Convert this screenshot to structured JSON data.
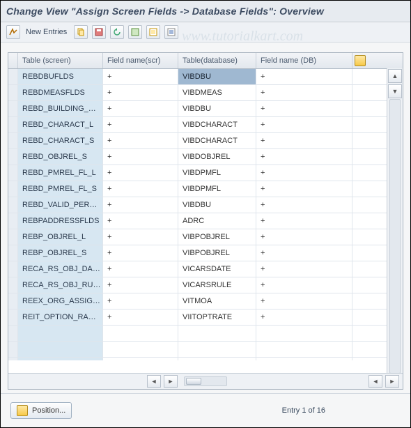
{
  "watermark": "www.tutorialkart.com",
  "title": "Change View \"Assign Screen Fields -> Database Fields\": Overview",
  "toolbar": {
    "new_entries_label": "New Entries"
  },
  "columns": {
    "c1": "Table (screen)",
    "c2": "Field name(scr)",
    "c3": "Table(database)",
    "c4": "Field name (DB)"
  },
  "rows": [
    {
      "ts": "REBDBUFLDS",
      "fs": "+",
      "td": "VIBDBU",
      "fd": "+",
      "sel": true
    },
    {
      "ts": "REBDMEASFLDS",
      "fs": "+",
      "td": "VIBDMEAS",
      "fd": "+"
    },
    {
      "ts": "REBD_BUILDING_…",
      "fs": "+",
      "td": "VIBDBU",
      "fd": "+"
    },
    {
      "ts": "REBD_CHARACT_L",
      "fs": "+",
      "td": "VIBDCHARACT",
      "fd": "+"
    },
    {
      "ts": "REBD_CHARACT_S",
      "fs": "+",
      "td": "VIBDCHARACT",
      "fd": "+"
    },
    {
      "ts": "REBD_OBJREL_S",
      "fs": "+",
      "td": "VIBDOBJREL",
      "fd": "+"
    },
    {
      "ts": "REBD_PMREL_FL_L",
      "fs": "+",
      "td": "VIBDPMFL",
      "fd": "+"
    },
    {
      "ts": "REBD_PMREL_FL_S",
      "fs": "+",
      "td": "VIBDPMFL",
      "fd": "+"
    },
    {
      "ts": "REBD_VALID_PER…",
      "fs": "+",
      "td": "VIBDBU",
      "fd": "+"
    },
    {
      "ts": "REBPADDRESSFLDS",
      "fs": "+",
      "td": "ADRC",
      "fd": "+"
    },
    {
      "ts": "REBP_OBJREL_L",
      "fs": "+",
      "td": "VIBPOBJREL",
      "fd": "+"
    },
    {
      "ts": "REBP_OBJREL_S",
      "fs": "+",
      "td": "VIBPOBJREL",
      "fd": "+"
    },
    {
      "ts": "RECA_RS_OBJ_DA…",
      "fs": "+",
      "td": "VICARSDATE",
      "fd": "+"
    },
    {
      "ts": "RECA_RS_OBJ_RU…",
      "fs": "+",
      "td": "VICARSRULE",
      "fd": "+"
    },
    {
      "ts": "REEX_ORG_ASSIG…",
      "fs": "+",
      "td": "VITMOA",
      "fd": "+"
    },
    {
      "ts": "REIT_OPTION_RA…",
      "fs": "+",
      "td": "VIITOPTRATE",
      "fd": "+"
    },
    {
      "ts": "",
      "fs": "",
      "td": "",
      "fd": ""
    },
    {
      "ts": "",
      "fs": "",
      "td": "",
      "fd": ""
    },
    {
      "ts": "",
      "fs": "",
      "td": "",
      "fd": ""
    }
  ],
  "footer": {
    "position_label": "Position...",
    "entry_text": "Entry 1 of 16"
  },
  "icons": {
    "toggle": "toggle-display-icon",
    "copy": "copy-icon",
    "save": "save-icon",
    "undo": "undo-icon",
    "select_all": "select-all-icon",
    "deselect": "deselect-icon",
    "delete": "delete-icon",
    "config": "config-columns-icon"
  }
}
